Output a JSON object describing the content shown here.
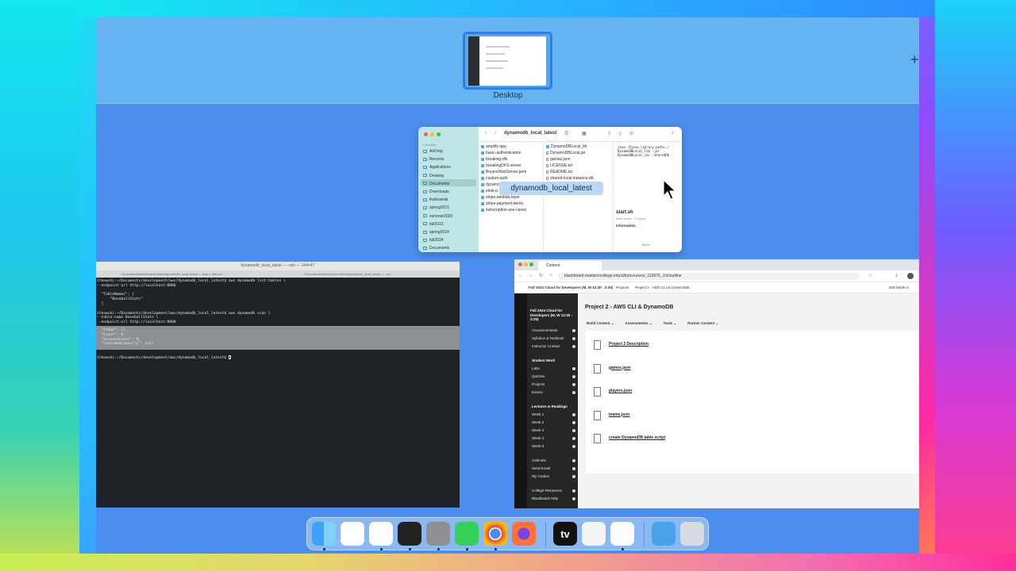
{
  "mission_control": {
    "space_label": "Desktop",
    "add_space_glyph": "+"
  },
  "finder": {
    "title": "dynamodb_local_latest",
    "tooltip": "dynamodb_local_latest",
    "sidebar_header": "Favorites",
    "sidebar": [
      "AirDrop",
      "Recents",
      "Applications",
      "Desktop",
      "Documents",
      "Downloads",
      "llwitkowski",
      "spring2023",
      "summer2023",
      "fall2023",
      "spring2024",
      "fall2024",
      "Documents"
    ],
    "col1": [
      "amplify-app",
      "basic-authentication",
      "breaking-dfs",
      "breakingDFS-server",
      "BryansWebServer.pem",
      "custom-auth",
      "dynamodb_local_latest",
      "elnle-p...",
      "stripe-lambda-layer",
      "stripe-payment-demo",
      "subscription-use-cases"
    ],
    "col2": [
      "DynamoDBLocal_lib",
      "DynamoDBLocal.jar",
      "games.json",
      "LICENSE.txt",
      "README.txt",
      "shared-local-instance.db"
    ],
    "preview_code": "java -Djava.library.path=./\nDynamoDBLocal_lib -jar\nDynamoDBLocal.jar -sharedDb",
    "preview_name": "start.sh",
    "preview_meta": "shell script - 77 bytes",
    "preview_info": "Information",
    "preview_more": "More..."
  },
  "terminal": {
    "title": "dynamodb_local_latest — -zsh — 144×47",
    "tab1": "~/Documents/development/aws/dynamodb_local_latest — java < start.sh",
    "tab2": "~/Documents/development/aws/dynamodb_local_latest — -zsh",
    "lines": [
      "itkowski:~/Documents/development/aws/dynamodb_local_latest$ aws dynamodb list-tables \\",
      "--endpoint-url http://localhost:8000",
      "",
      "  \"TableNames\": [",
      "      \"BaseballStats\"",
      "  ]",
      "",
      "itkowski:~/Documents/development/aws/dynamodb_local_latest$ aws dynamodb scan \\",
      "--table-name BaseballStats \\",
      "--endpoint-url http://localhost:8000"
    ],
    "highlight_lines": [
      "  \"Items\": [],",
      "  \"Count\": 0,",
      "  \"ScannedCount\": 0,",
      "  \"ConsumedCapacity\": null"
    ],
    "prompt": "itkowski:~/Documents/development/aws/dynamodb_local_latest$ "
  },
  "browser": {
    "tab_title": "Content",
    "url": "blackboard.madisoncollege.edu/ultra/courses/_113976_1/cl/outline",
    "course_header": "Fall 2024 Cloud for Developers (M, W 12:30 - 2:20)",
    "breadcrumb_projects": "Projects",
    "breadcrumb_current": "Project 2 - AWS CLI & DynamoDB",
    "edit_mode": "Edit Mode is",
    "course_nav_title": "Fall 2024 Cloud for Developers (M, W 12:30 - 2:20)",
    "nav_items_a": [
      "Announcements",
      "Syllabus & Textbook",
      "Instructor Contact"
    ],
    "nav_head_student": "Student Work",
    "nav_items_b": [
      "Labs",
      "Quizzes",
      "Projects",
      "Exams"
    ],
    "nav_head_lectures": "Lectures & Readings",
    "nav_items_c": [
      "Week 1",
      "Week 2",
      "Week 3",
      "Week 4",
      "Week 5"
    ],
    "nav_items_d": [
      "Calendar",
      "Send Email",
      "My Grades"
    ],
    "nav_items_e": [
      "College Resources",
      "Blackboard Help"
    ],
    "page_title": "Project 2 - AWS CLI & DynamoDB",
    "menu": [
      "Build Content",
      "Assessments",
      "Tools",
      "Partner Content"
    ],
    "items": [
      "Project 2 Description",
      "games.json",
      "players.json",
      "teams.json",
      "create DynamoDB table script"
    ]
  },
  "dock": {
    "apps": [
      "finder-icon",
      "slack-icon",
      "vscode-icon",
      "terminal-icon",
      "system-settings-icon",
      "messages-icon",
      "chrome-icon",
      "firefox-icon",
      "appletv-icon",
      "textedit-icon",
      "camtasia-icon",
      "folder-icon",
      "trash-icon"
    ],
    "appletv_label": "tv"
  }
}
